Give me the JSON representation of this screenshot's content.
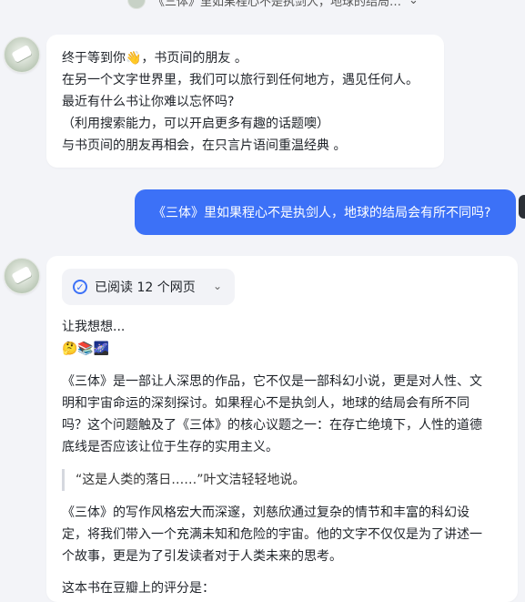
{
  "header": {
    "title": "《三体》里如果程心不是执剑人，地球的结局…",
    "chevron": "chevron-down-icon"
  },
  "welcome": {
    "lines": [
      "终于等到你👋，书页间的朋友 。",
      "在另一个文字世界里，我们可以旅行到任何地方，遇见任何人。",
      "最近有什么书让你难以忘怀吗?",
      "（利用搜索能力，可以开启更多有趣的话题噢）",
      "与书页间的朋友再相会，在只言片语间重温经典 。"
    ]
  },
  "user_message": {
    "text": "《三体》里如果程心不是执剑人，地球的结局会有所不同吗?"
  },
  "answer": {
    "read_chip": {
      "label": "已阅读 12 个网页"
    },
    "thinking": "让我想想...",
    "emojis": "🤔📚🌌",
    "p1": [
      "《三体》是一部让人深思的作品，它不仅是一部科幻小说，更是对人性、文",
      "明和宇宙命运的深刻探讨。如果程心不是执剑人，地球的结局会有所不同",
      "吗？这个问题触及了《三体》的核心议题之一：在存亡绝境下，人性的道德",
      "底线是否应该让位于生存的实用主义。"
    ],
    "quote": "“这是人类的落日……”叶文洁轻轻地说。",
    "p2": [
      "《三体》的写作风格宏大而深邃，刘慈欣通过复杂的情节和丰富的科幻设",
      "定，将我们带入一个充满未知和危险的宇宙。他的文字不仅仅是为了讲述一",
      "个故事，更是为了引发读者对于人类未来的思考。"
    ],
    "p3_partial": "这本书在豆瓣上的评分是："
  },
  "colors": {
    "accent": "#3c71f7",
    "background": "#f3f4f8",
    "bubble": "#ffffff"
  }
}
